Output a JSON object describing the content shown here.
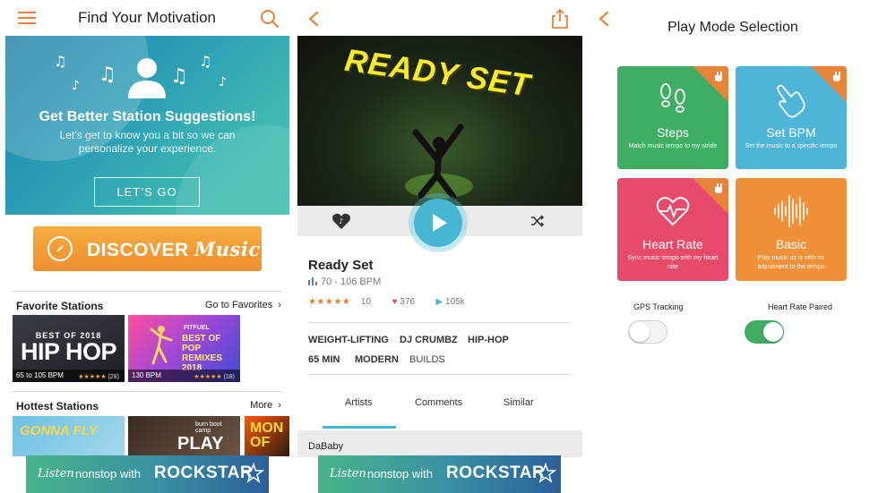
{
  "panel1": {
    "title": "Find Your Motivation",
    "hero": {
      "title": "Get Better Station Suggestions!",
      "subtitle": "Let’s get to know you a bit so we can personalize your experience.",
      "button": "LET’S GO"
    },
    "discover": {
      "word1": "DISCOVER",
      "word2": "Music"
    },
    "favorite": {
      "title": "Favorite Stations",
      "link": "Go to Favorites",
      "cards": [
        {
          "top_text": "BEST OF 2018",
          "main_text": "HIP HOP",
          "bpm": "65 to 105 BPM",
          "stars": "★★★★★",
          "count": "(28)"
        },
        {
          "brand": "FITFUEL",
          "main_text": "BEST OF POP REMIXES 2018",
          "bpm": "130 BPM",
          "stars": "★★★★★",
          "count": "(18)"
        }
      ]
    },
    "hottest": {
      "title": "Hottest Stations",
      "link": "More",
      "cards": [
        {
          "text": "GONNA FLY"
        },
        {
          "small": "burn boot camp",
          "text": "PLAY"
        },
        {
          "text": "MON OF"
        }
      ]
    },
    "banner": {
      "listen": "Listen",
      "nonstop": "nonstop with",
      "brand": "ROCKSTAR"
    }
  },
  "panel2": {
    "hero_text": "READY SET",
    "track": {
      "title": "Ready Set",
      "bpm": "70 - 106 BPM",
      "stars": "★★★★★",
      "rating_count": "10",
      "hearts": "376",
      "plays": "105k"
    },
    "tags": [
      "WEIGHT-LIFTING",
      "DJ CRUMBZ",
      "HIP-HOP",
      "65 MIN",
      "MODERN",
      "BUILDS"
    ],
    "tabs": [
      "Artists",
      "Comments",
      "Similar"
    ],
    "active_tab": "Artists",
    "artist": "DaBaby",
    "banner": {
      "listen": "Listen",
      "nonstop": "nonstop with",
      "brand": "ROCKSTAR"
    }
  },
  "panel3": {
    "title": "Play Mode Selection",
    "modes": [
      {
        "title": "Steps",
        "desc": "Match music tempo to my stride",
        "color": "#3fae62",
        "flag": "#e8833a",
        "icon": "footprints-icon"
      },
      {
        "title": "Set BPM",
        "desc": "Set the music to a specific tempo",
        "color": "#4eb4d8",
        "flag": "#e8833a",
        "icon": "tap-hand-icon"
      },
      {
        "title": "Heart Rate",
        "desc": "Sync music tempo with my heart rate",
        "color": "#e84a6b",
        "flag": "#e8833a",
        "icon": "heartbeat-icon"
      },
      {
        "title": "Basic",
        "desc": "Play music as is with no adjustment to the tempo",
        "color": "#f0913a",
        "flag": null,
        "icon": "waveform-icon"
      }
    ],
    "toggles": [
      {
        "label": "GPS Tracking",
        "on": false
      },
      {
        "label": "Heart Rate Paired",
        "on": true
      }
    ]
  },
  "colors": {
    "accent": "#e8833a",
    "play": "#47b6d3",
    "toggle_on": "#3fae62"
  }
}
